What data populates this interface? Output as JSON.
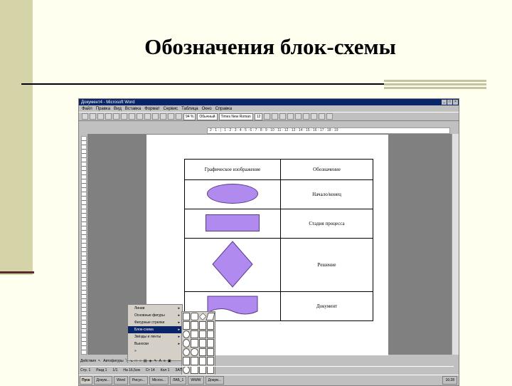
{
  "slide": {
    "title": "Обозначения блок-схемы"
  },
  "window": {
    "title": "Документ4 - Microsoft Word",
    "menu": [
      "Файл",
      "Правка",
      "Вид",
      "Вставка",
      "Формат",
      "Сервис",
      "Таблица",
      "Окно",
      "Справка"
    ],
    "zoom": "94 %",
    "style": "Обычный",
    "font": "Times New Roman",
    "size": "12",
    "ruler": "· 2 · 1 · | · 1 · 2 · 3 · 4 · 5 · 6 · 7 · 8 · 9 · 10 · 11 · 12 · 13 · 14 · 15 · 16 · 17 · 18 · 19"
  },
  "table": {
    "headers": [
      "Графическое изображение",
      "Обозначение"
    ],
    "rows": [
      {
        "shape": "oval",
        "label": "Начало/конец"
      },
      {
        "shape": "rectangle",
        "label": "Стадия процесса"
      },
      {
        "shape": "diamond",
        "label": "Решение"
      },
      {
        "shape": "document",
        "label": "Документ"
      }
    ],
    "shape_color": "#b18af0"
  },
  "draw_menu": [
    "Линии",
    "Основные фигуры",
    "Фигурные стрелки",
    "Блок-схема",
    "Звёзды и ленты",
    "Выноски",
    "»"
  ],
  "draw_toolbar": {
    "draw": "Действия",
    "autoshapes": "Автофигуры"
  },
  "status": {
    "page": "Стр. 1",
    "section": "Разд 1",
    "pages": "1/1",
    "pos": "На 16,5см",
    "line": "Ст 14",
    "col": "Кол 1",
    "mode": "ЗАП"
  },
  "taskbar": {
    "start": "Пуск",
    "tasks": [
      "Докум...",
      "Word",
      "Рисун...",
      "Micros...",
      "ЛАБ_1",
      "WWW",
      "Докум..."
    ],
    "clock": "16:28"
  }
}
